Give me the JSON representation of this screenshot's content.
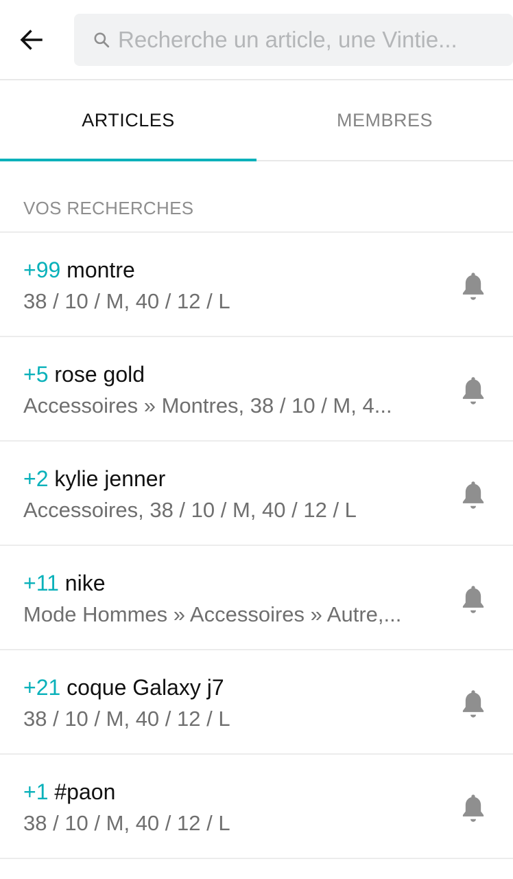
{
  "search": {
    "placeholder": "Recherche un article, une Vintie...",
    "value": ""
  },
  "tabs": [
    {
      "label": "ARTICLES",
      "active": true
    },
    {
      "label": "MEMBRES",
      "active": false
    }
  ],
  "section": {
    "title": "VOS RECHERCHES"
  },
  "searches": [
    {
      "count": "+99",
      "query": "montre",
      "filters": "38 / 10 / M, 40 / 12 / L"
    },
    {
      "count": "+5",
      "query": "rose gold",
      "filters": "Accessoires » Montres, 38 / 10 / M, 4..."
    },
    {
      "count": "+2",
      "query": "kylie jenner",
      "filters": "Accessoires, 38 / 10 / M, 40 / 12 / L"
    },
    {
      "count": "+11",
      "query": "nike",
      "filters": "Mode Hommes » Accessoires » Autre,..."
    },
    {
      "count": "+21",
      "query": "coque Galaxy j7",
      "filters": "38 / 10 / M, 40 / 12 / L"
    },
    {
      "count": "+1",
      "query": "#paon",
      "filters": "38 / 10 / M, 40 / 12 / L"
    }
  ],
  "icons": {
    "back": "arrow-left-icon",
    "search": "search-icon",
    "bell": "bell-icon"
  },
  "colors": {
    "accent": "#09b1ba",
    "icon_gray": "#8f8f8f"
  }
}
